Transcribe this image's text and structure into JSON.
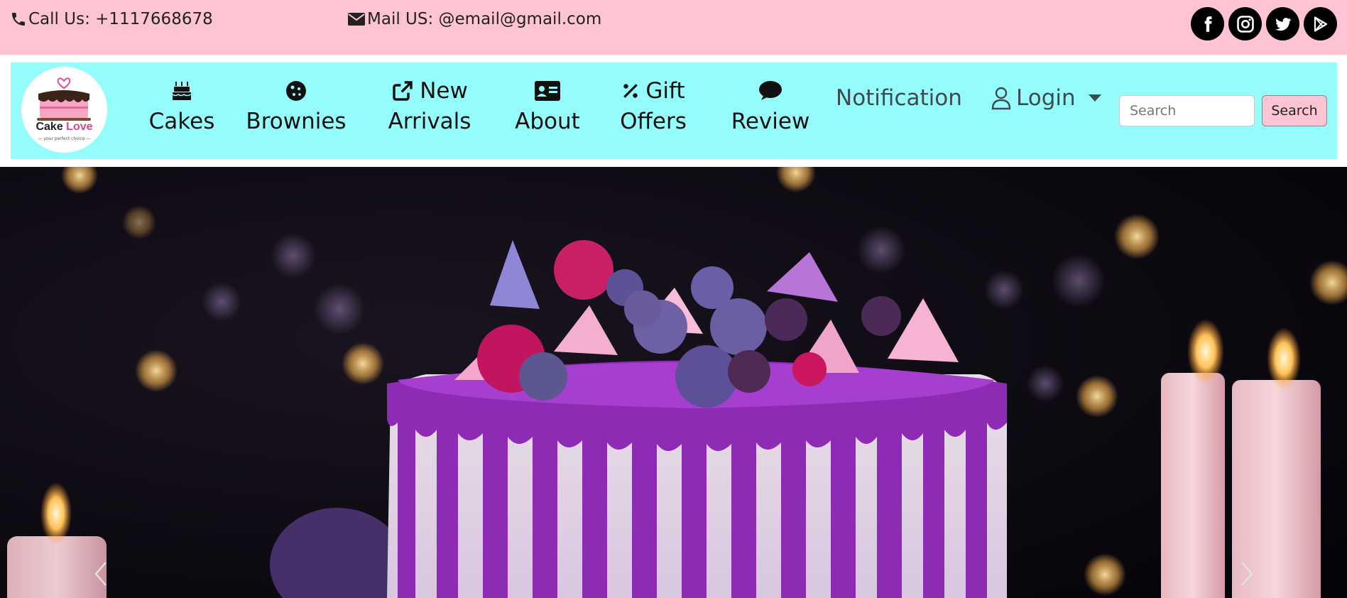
{
  "topbar": {
    "phone": "Call Us: +1117668678",
    "mail": "Mail US: @email@gmail.com",
    "socials": [
      "facebook-icon",
      "instagram-icon",
      "twitter-icon",
      "google-play-icon"
    ]
  },
  "logo": {
    "brand_1": "Cake ",
    "brand_2": "Love",
    "tagline": "— your perfect choice —"
  },
  "nav": {
    "cakes": "Cakes",
    "brownies": "Brownies",
    "new_1": "New",
    "new_2": "Arrivals",
    "about": "About",
    "gift_1": "Gift",
    "gift_2": "Offers",
    "review": "Review",
    "notification": "Notification",
    "login": "Login"
  },
  "search": {
    "placeholder": "Search",
    "button": "Search"
  },
  "colors": {
    "topbar": "#ffc4d3",
    "navbar": "#94fcfb",
    "search_button": "#ffc4d3"
  },
  "hero": {
    "image": "purple-drip-cake-with-blueberries-and-candles"
  }
}
